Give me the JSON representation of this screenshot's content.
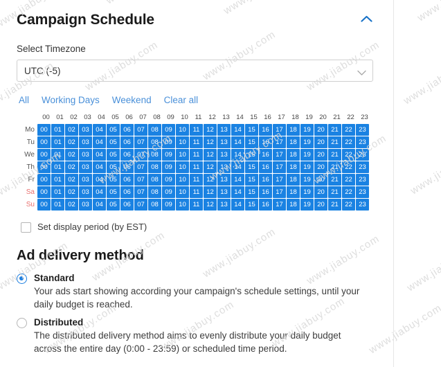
{
  "panel": {
    "title": "Campaign Schedule",
    "collapse_icon": "chevron-up-icon"
  },
  "timezone": {
    "label": "Select Timezone",
    "selected": "UTC (-5)",
    "options": [
      "UTC (-5)"
    ],
    "chevron_icon": "chevron-down-icon"
  },
  "quick_links": [
    {
      "label": "All"
    },
    {
      "label": "Working Days"
    },
    {
      "label": "Weekend"
    },
    {
      "label": "Clear all"
    }
  ],
  "schedule": {
    "hours": [
      "00",
      "01",
      "02",
      "03",
      "04",
      "05",
      "06",
      "07",
      "08",
      "09",
      "10",
      "11",
      "12",
      "13",
      "14",
      "15",
      "16",
      "17",
      "18",
      "19",
      "20",
      "21",
      "22",
      "23"
    ],
    "days": [
      {
        "label": "Mo",
        "weekend": false,
        "selected_all": true
      },
      {
        "label": "Tu",
        "weekend": false,
        "selected_all": true
      },
      {
        "label": "We",
        "weekend": false,
        "selected_all": true
      },
      {
        "label": "Th",
        "weekend": false,
        "selected_all": true
      },
      {
        "label": "Fr",
        "weekend": false,
        "selected_all": true
      },
      {
        "label": "Sa",
        "weekend": true,
        "selected_all": true
      },
      {
        "label": "Su",
        "weekend": true,
        "selected_all": true
      }
    ],
    "selected_color": "#1a82e2",
    "unselected_color": "#f0f0f0"
  },
  "display_period": {
    "label": "Set display period (by EST)",
    "checked": false
  },
  "ad_delivery": {
    "title": "Ad delivery method",
    "options": [
      {
        "name": "Standard",
        "selected": true,
        "description": "Your ads start showing according your campaign's schedule settings, until your daily budget is reached."
      },
      {
        "name": "Distributed",
        "selected": false,
        "description": "The distributed delivery method aims to evenly distribute your daily budget across the entire day (0:00 - 23:59) or scheduled time period."
      }
    ]
  },
  "watermark": {
    "text": "www.jiabuy.com"
  },
  "colors": {
    "accent": "#1a82e2",
    "link": "#4a90d9",
    "weekend_label": "#e8706f",
    "text": "#333333"
  }
}
